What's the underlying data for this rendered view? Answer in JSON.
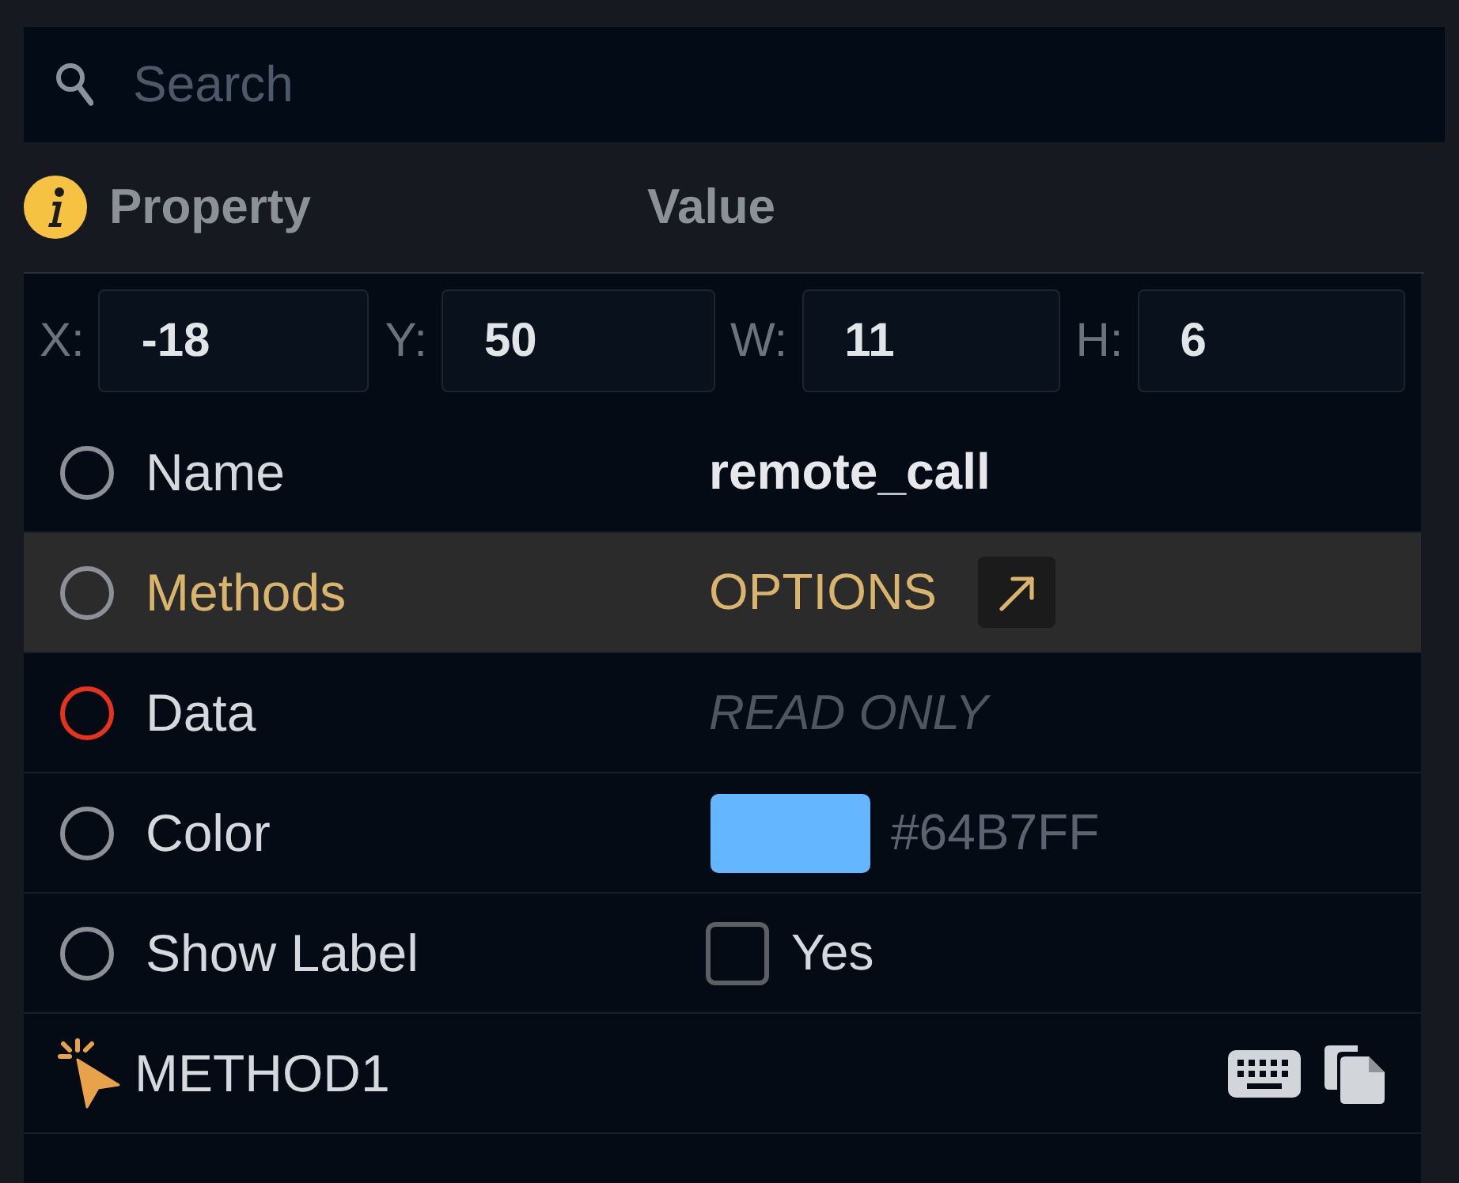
{
  "search": {
    "placeholder": "Search"
  },
  "header": {
    "property": "Property",
    "value": "Value"
  },
  "geometry": [
    {
      "label": "X:",
      "value": "-18"
    },
    {
      "label": "Y:",
      "value": "50"
    },
    {
      "label": "W:",
      "value": "11"
    },
    {
      "label": "H:",
      "value": "6"
    }
  ],
  "properties": [
    {
      "kind": "text",
      "name": "Name",
      "value": "remote_call",
      "color": "#8c9096",
      "selected": false
    },
    {
      "kind": "options",
      "name": "Methods",
      "value": "OPTIONS",
      "color": "#8c9096",
      "selected": true
    },
    {
      "kind": "readonly",
      "name": "Data",
      "value": "READ ONLY",
      "color": "#e8321e",
      "selected": false
    },
    {
      "kind": "color",
      "name": "Color",
      "value": "#64B7FF",
      "color": "#8c9096",
      "selected": false
    },
    {
      "kind": "checkbox",
      "name": "Show Label",
      "value": "Yes",
      "checked": false,
      "color": "#8c9096",
      "selected": false
    }
  ],
  "method": {
    "label": "METHOD1"
  }
}
